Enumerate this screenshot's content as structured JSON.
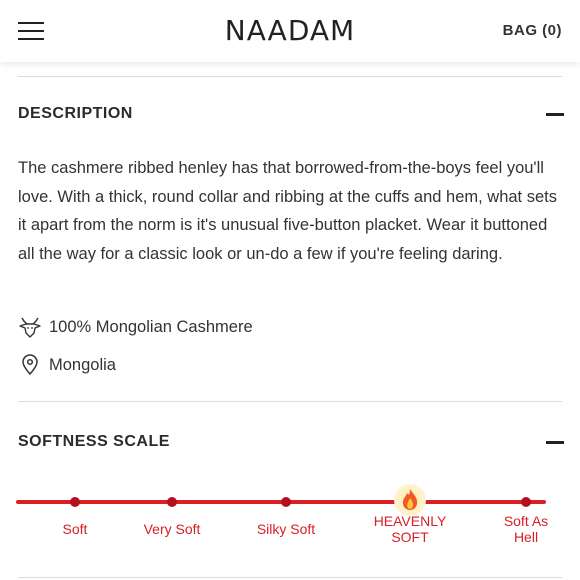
{
  "header": {
    "logo": "NAADAM",
    "bag_label": "BAG (0)"
  },
  "description": {
    "title": "DESCRIPTION",
    "text": "The cashmere ribbed henley has that borrowed-from-the-boys feel you'll love. With a thick, round collar and ribbing at the cuffs and hem, what sets it apart from the norm is it's unusual five-button placket. Wear it buttoned all the way for a classic look or un-do a few if you're feeling daring.",
    "features": [
      {
        "icon": "goat-icon",
        "label": "100% Mongolian Cashmere"
      },
      {
        "icon": "location-pin-icon",
        "label": "Mongolia"
      }
    ]
  },
  "softness": {
    "title": "SOFTNESS SCALE",
    "levels": [
      {
        "line1": "Soft",
        "line2": ""
      },
      {
        "line1": "Very Soft",
        "line2": ""
      },
      {
        "line1": "Silky Soft",
        "line2": ""
      },
      {
        "line1": "HEAVENLY",
        "line2": "SOFT"
      },
      {
        "line1": "Soft As",
        "line2": "Hell"
      }
    ],
    "selected_index": 3,
    "selected_icon": "flame-icon",
    "color": "#d92027"
  }
}
